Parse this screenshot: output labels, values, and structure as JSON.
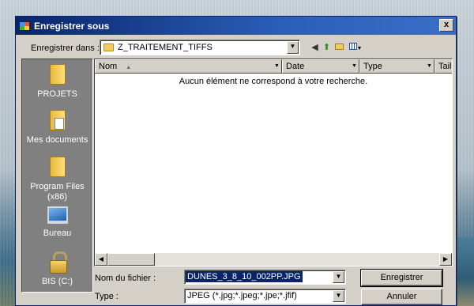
{
  "window": {
    "title": "Enregistrer sous",
    "close_glyph": "x"
  },
  "location": {
    "label": "Enregistrer dans :",
    "value": "Z_TRAITEMENT_TIFFS"
  },
  "toolbar_icons": [
    "back-icon",
    "up-folder-icon",
    "new-folder-icon",
    "view-menu-icon"
  ],
  "places": [
    {
      "label": "PROJETS",
      "icon": "folder-icon"
    },
    {
      "label": "Mes documents",
      "icon": "documents-icon"
    },
    {
      "label": "Program Files (x86)",
      "icon": "folder-icon"
    },
    {
      "label": "Bureau",
      "icon": "desktop-icon"
    },
    {
      "label": "BIS (C:)",
      "icon": "drive-lock-icon"
    }
  ],
  "columns": [
    {
      "label": "Nom",
      "sort_glyph": "▲"
    },
    {
      "label": "Date"
    },
    {
      "label": "Type"
    },
    {
      "label": "Tail"
    }
  ],
  "empty_message": "Aucun élément ne correspond à votre recherche.",
  "filename": {
    "label": "Nom du fichier :",
    "value": "DUNES_3_8_10_002PP.JPG"
  },
  "filetype": {
    "label": "Type :",
    "value": "JPEG (*.jpg;*.jpeg;*.jpe;*.jfif)"
  },
  "buttons": {
    "save": "Enregistrer",
    "cancel": "Annuler"
  },
  "colors": {
    "title_bar": "#0a246a",
    "face": "#d4d0c8",
    "places_panel": "#808080"
  }
}
